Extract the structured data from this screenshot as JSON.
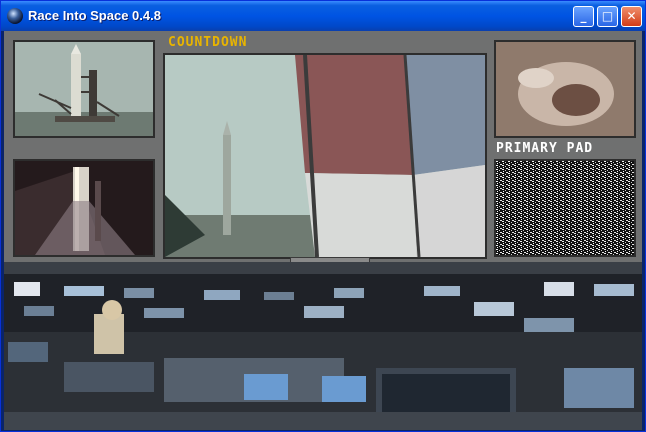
{
  "window": {
    "title": "Race Into Space 0.4.8",
    "controls": {
      "minimize": "_",
      "maximize": "□",
      "close": "✕"
    }
  },
  "labels": {
    "countdown": "COUNTDOWN",
    "primary_pad": "PRIMARY PAD"
  },
  "colors": {
    "countdown_text": "#e8b400",
    "pad_text": "#ffffff",
    "titlebar": "#0054e3"
  },
  "icons": {
    "app": "earth-icon",
    "vcr": [
      "rewind-icon",
      "stop-icon",
      "play-icon",
      "fast-forward-icon"
    ]
  }
}
